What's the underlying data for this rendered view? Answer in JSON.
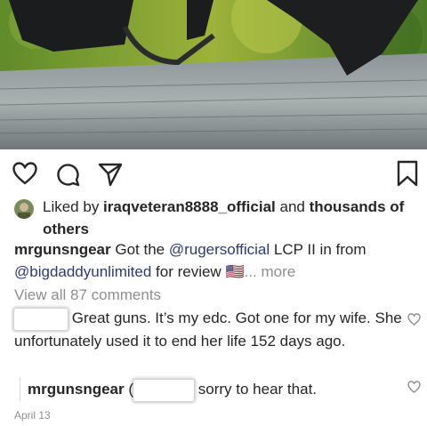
{
  "post": {
    "likes": {
      "prefix": "Liked by ",
      "user": "iraqveteran8888_official",
      "middle": " and ",
      "rest": "thousands of others"
    },
    "caption": {
      "username": "mrgunsngear",
      "text1": " Got the ",
      "mention1": "@rugersofficial",
      "text2": " LCP II in from ",
      "mention2": "@bigdaddyunlimited",
      "text3": " for review ",
      "flag": "🇺🇸",
      "more": "... more"
    },
    "view_all": "View all 87 comments"
  },
  "comments": [
    {
      "text": "Great guns. It’s my edc. Got one for my wife. She unfortunately used it to end her life 152 days ago."
    }
  ],
  "reply": {
    "username": "mrgunsngear",
    "mention_open": "(",
    "text": "sorry to hear that."
  },
  "date": "April 13",
  "icons": [
    "heart-icon",
    "comment-icon",
    "share-icon",
    "bookmark-icon",
    "avatar-icon",
    "small-heart-icon"
  ],
  "colors": {
    "mention": "#2b3a7a",
    "muted": "#8e8e8e",
    "text": "#262626"
  }
}
